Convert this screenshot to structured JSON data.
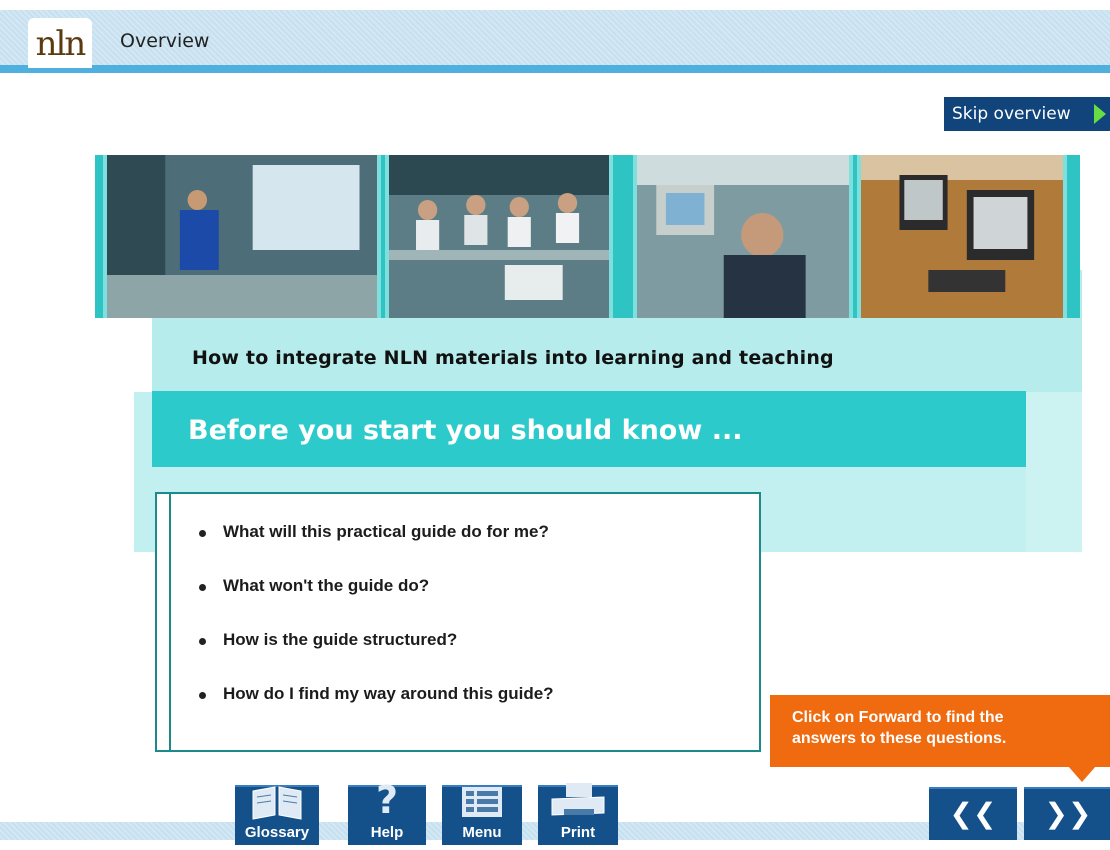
{
  "header": {
    "logo_text": "nln",
    "title": "Overview"
  },
  "skip": {
    "label": "Skip overview"
  },
  "main": {
    "subtitle": "How to integrate NLN materials into learning and teaching",
    "banner": "Before you start you should know ...",
    "questions": [
      "What will this practical guide do for me?",
      "What won't the guide do?",
      "How is the guide structured?",
      "How do I find my way around this guide?"
    ]
  },
  "callout": {
    "line1": "Click on Forward to find the",
    "line2": "answers to these questions."
  },
  "toolbar": {
    "glossary": "Glossary",
    "help": "Help",
    "menu": "Menu",
    "print": "Print"
  },
  "nav": {
    "back_icon": "double-chevron-left-icon",
    "forward_icon": "double-chevron-right-icon"
  },
  "colors": {
    "teal": "#2ccaca",
    "navy": "#14508a",
    "orange": "#f06a0f",
    "header_line": "#4fb0e0"
  }
}
